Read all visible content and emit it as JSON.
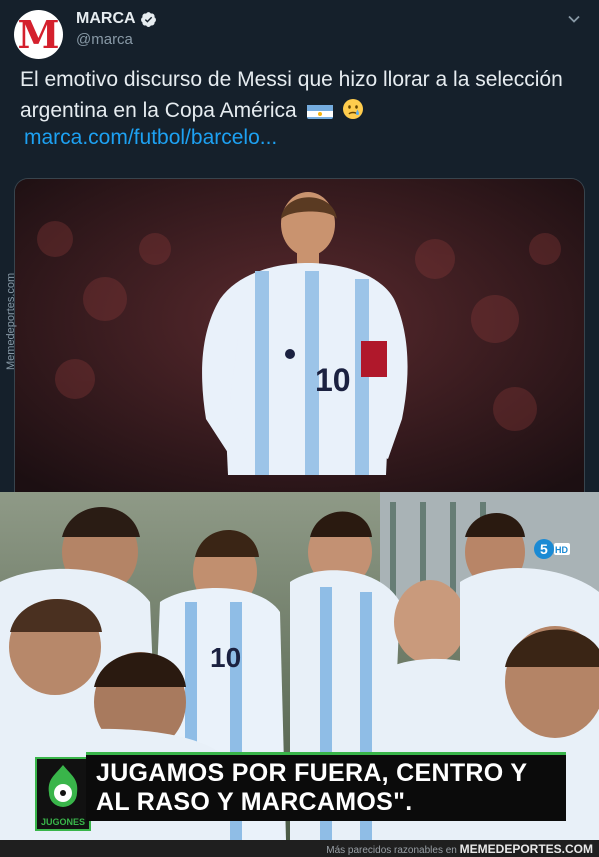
{
  "tweet": {
    "account_name": "MARCA",
    "handle": "@marca",
    "avatar_letter": "M",
    "text": "El emotivo discurso de Messi que hizo llorar a la selección argentina en la Copa América",
    "link": "marca.com/futbol/barcelo...",
    "emojis": [
      "argentina-flag-icon",
      "crying-face-icon"
    ],
    "colors": {
      "background": "#15202b",
      "link": "#1da1f2",
      "text": "#e6ecf0",
      "secondary": "#8899a6"
    }
  },
  "watermark": "Memedeportes.com",
  "video_frame": {
    "caption": "JUGAMOS POR FUERA, CENTRO Y AL RASO Y MARCAMOS\".",
    "channel_logo_text": "JUGONES",
    "tv_logo": "5HD",
    "accent_color": "#39b54a"
  },
  "footer": {
    "prefix": "Más parecidos razonables en",
    "site": "MEMEDEPORTES.COM"
  }
}
